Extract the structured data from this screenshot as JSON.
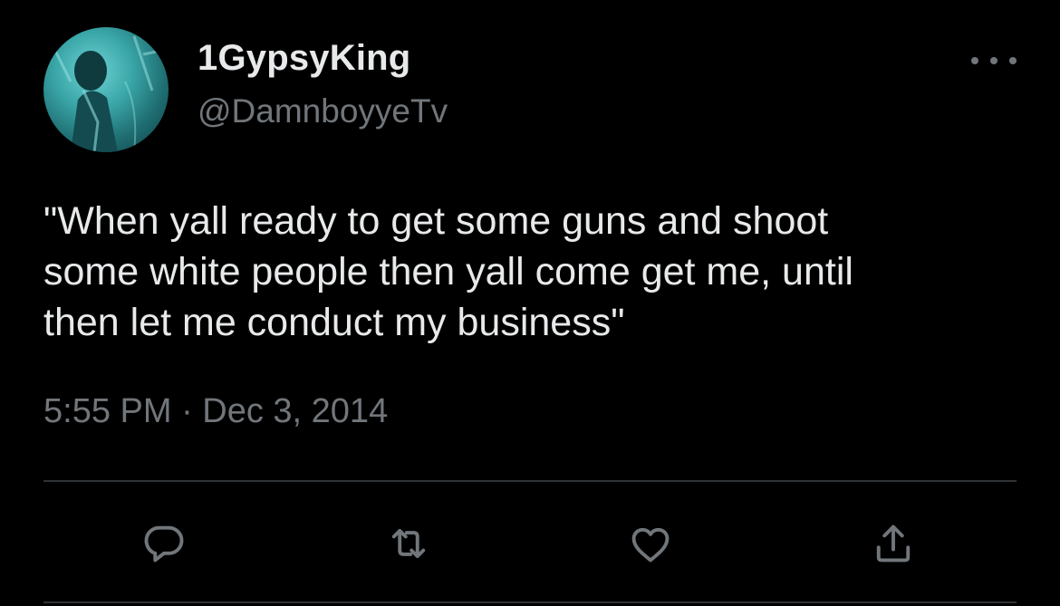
{
  "user": {
    "display_name": "1GypsyKing",
    "handle": "@DamnboyyeTv",
    "avatar_icon": "profile-photo"
  },
  "tweet": {
    "text": "\"When yall ready to get some guns and shoot\nsome white people then yall come get me, until\nthen let me conduct my business\"",
    "timestamp": "5:55 PM · Dec 3, 2014"
  },
  "actions": {
    "reply_icon": "reply-icon",
    "retweet_icon": "retweet-icon",
    "like_icon": "heart-icon",
    "share_icon": "share-icon"
  },
  "colors": {
    "background": "#000000",
    "primary_text": "#e7e9ea",
    "secondary_text": "#71767b",
    "divider": "#2f3336"
  }
}
